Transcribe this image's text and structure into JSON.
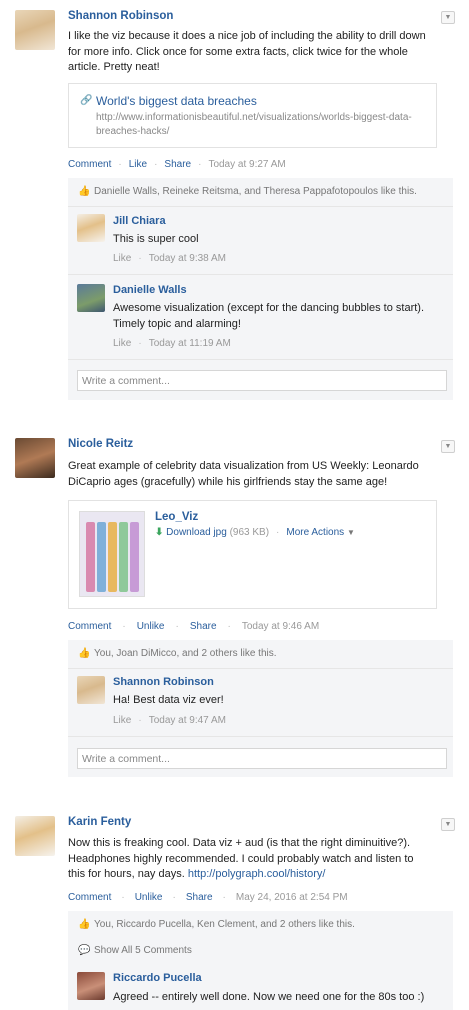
{
  "posts": [
    {
      "author": "Shannon Robinson",
      "body": "I like the viz because it does a nice job of including the ability to drill down for more info. Click once for some extra facts, click twice for the whole article. Pretty neat!",
      "link": {
        "title": "World's biggest data breaches",
        "url": "http://www.informationisbeautiful.net/visualizations/worlds-biggest-data-breaches-hacks/"
      },
      "actions": {
        "comment": "Comment",
        "like": "Like",
        "share": "Share",
        "time": "Today at 9:27 AM"
      },
      "likes": "Danielle Walls, Reineke Reitsma, and Theresa Pappafotopoulos like this.",
      "replies": [
        {
          "name": "Jill Chiara",
          "body": "This is super cool",
          "like": "Like",
          "time": "Today at 9:38 AM"
        },
        {
          "name": "Danielle Walls",
          "body": "Awesome visualization (except for the dancing bubbles to start). Timely topic and alarming!",
          "like": "Like",
          "time": "Today at 11:19 AM"
        }
      ],
      "comment_placeholder": "Write a comment..."
    },
    {
      "author": "Nicole Reitz",
      "body": "Great example of celebrity data visualization from US Weekly: Leonardo DiCaprio ages (gracefully) while his girlfriends stay the same age!",
      "file": {
        "name": "Leo_Viz",
        "download": "Download jpg",
        "size": "(963 KB)",
        "more": "More Actions"
      },
      "actions": {
        "comment": "Comment",
        "like": "Unlike",
        "share": "Share",
        "time": "Today at 9:46 AM"
      },
      "likes": "You, Joan DiMicco, and 2 others like this.",
      "replies": [
        {
          "name": "Shannon Robinson",
          "body": "Ha! Best data viz ever!",
          "like": "Like",
          "time": "Today at 9:47 AM"
        }
      ],
      "comment_placeholder": "Write a comment..."
    },
    {
      "author": "Karin Fenty",
      "body": "Now this is freaking cool. Data viz + aud (is that the right diminuitive?). Headphones highly recommended. I could probably watch and listen to this for hours, nay days.",
      "body_link": "http://polygraph.cool/history/",
      "actions": {
        "comment": "Comment",
        "like": "Unlike",
        "share": "Share",
        "time": "May 24, 2016 at 2:54 PM"
      },
      "likes": "You, Riccardo Pucella, Ken Clement, and 2 others like this.",
      "show_all": "Show All 5 Comments",
      "replies": [
        {
          "name": "Riccardo Pucella",
          "body": "Agreed -- entirely well done. Now we need one for the 80s too :)"
        }
      ]
    }
  ],
  "colors": {
    "link": "#2a5e9c",
    "thread_bg": "#f4f5f7",
    "muted": "#999999"
  },
  "icons": [
    "caret-down-icon",
    "link-icon",
    "thumbs-up-icon",
    "download-icon",
    "speech-bubble-icon"
  ]
}
